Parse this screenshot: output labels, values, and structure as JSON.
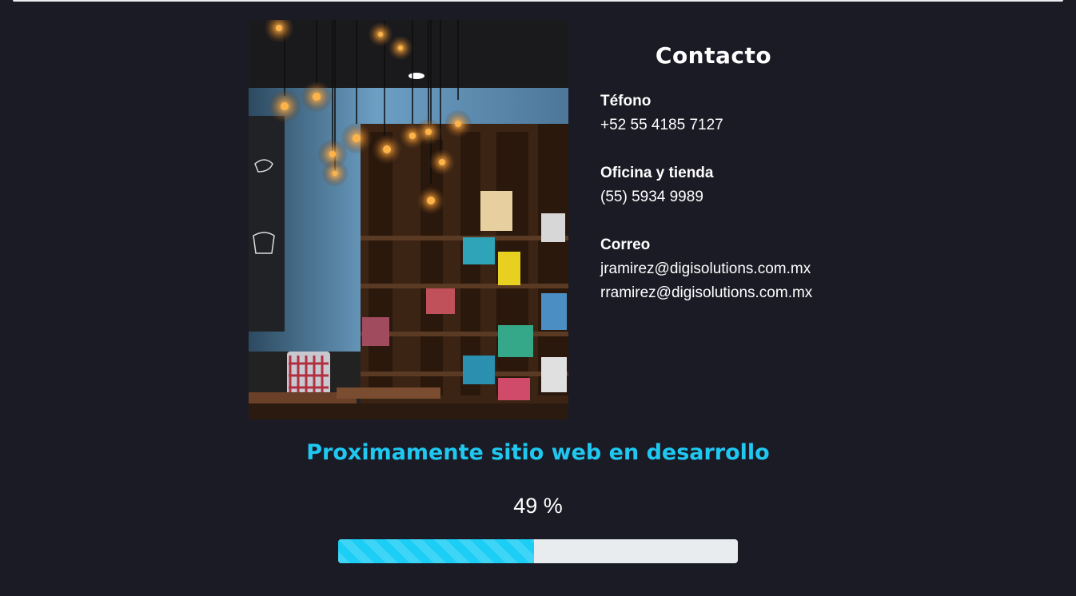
{
  "contact": {
    "title": "Contacto",
    "phone_label": "Téfono",
    "phone_value": "+52 55 4185 7127",
    "office_label": "Oficina y tienda",
    "office_value": "(55) 5934 9989",
    "email_label": "Correo",
    "emails": [
      "jramirez@digisolutions.com.mx",
      "rramirez@digisolutions.com.mx"
    ]
  },
  "status": {
    "heading": "Proximamente sitio web en desarrollo",
    "percent_text": "49 %",
    "progress": 0.49
  },
  "colors": {
    "background": "#1b1b25",
    "accent": "#1fc8f1",
    "progress_track": "#e9ecef"
  },
  "image": {
    "subject": "cafe interior with hanging Edison bulbs and bookshelves"
  }
}
